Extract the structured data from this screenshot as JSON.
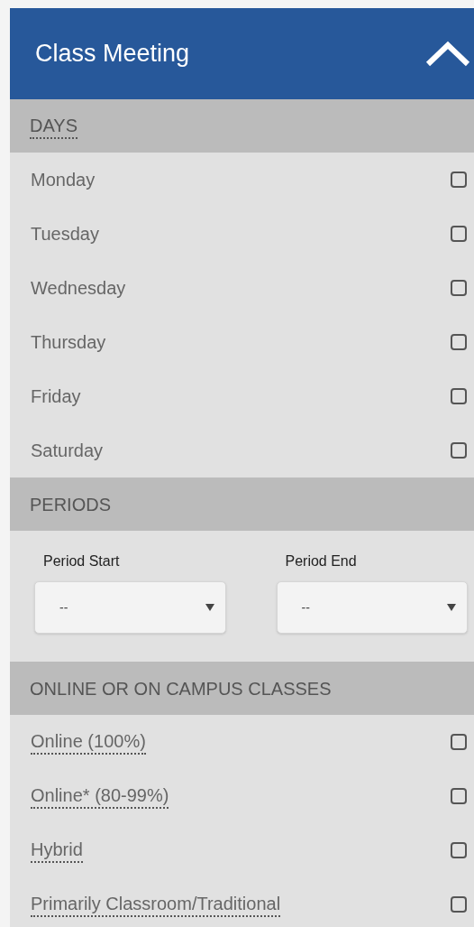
{
  "panel": {
    "title": "Class Meeting",
    "expanded": true
  },
  "sections": [
    {
      "kind": "checklist",
      "heading": "DAYS",
      "heading_help": true,
      "items": [
        {
          "label": "Monday",
          "help": false,
          "checked": false
        },
        {
          "label": "Tuesday",
          "help": false,
          "checked": false
        },
        {
          "label": "Wednesday",
          "help": false,
          "checked": false
        },
        {
          "label": "Thursday",
          "help": false,
          "checked": false
        },
        {
          "label": "Friday",
          "help": false,
          "checked": false
        },
        {
          "label": "Saturday",
          "help": false,
          "checked": false
        }
      ]
    },
    {
      "kind": "selects",
      "heading": "PERIODS",
      "heading_help": false,
      "fields": [
        {
          "label": "Period Start",
          "value": "--"
        },
        {
          "label": "Period End",
          "value": "--"
        }
      ]
    },
    {
      "kind": "checklist",
      "heading": "ONLINE OR ON CAMPUS CLASSES",
      "heading_help": false,
      "items": [
        {
          "label": "Online (100%)",
          "help": true,
          "checked": false
        },
        {
          "label": "Online* (80-99%)",
          "help": true,
          "checked": false
        },
        {
          "label": "Hybrid",
          "help": true,
          "checked": false
        },
        {
          "label": "Primarily Classroom/Traditional",
          "help": true,
          "checked": false
        }
      ]
    }
  ]
}
